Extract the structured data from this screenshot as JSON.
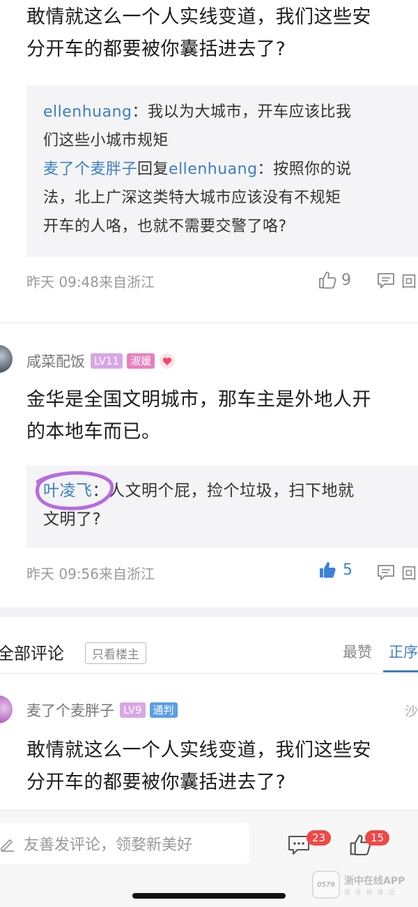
{
  "comment_top": {
    "text_line1": "敢情就这么一个人实线变道，我们这些安",
    "text_line2": "分开车的都要被你囊括进去了?",
    "replies": [
      {
        "user": "ellenhuang",
        "sep": "：",
        "text1": "我以为大城市，开车应该比我",
        "text2": "们这些小城市规矩"
      },
      {
        "user": "麦了个麦胖子",
        "action": "回复",
        "target": "ellenhuang",
        "sep": "：",
        "text1": "按照你的说",
        "text2": "法，北上广深这类特大城市应该没有不规矩",
        "text3": "开车的人咯，也就不需要交警了咯?"
      }
    ],
    "meta": "昨天 09:48来自浙江",
    "likes": "9",
    "reply_label": "回"
  },
  "comment_second": {
    "user": "咸菜配饭",
    "level_badge": "LV11",
    "title_badge": "淑媛",
    "text_line1": "金华是全国文明城市，那车主是外地人开",
    "text_line2": "的本地车而已。",
    "reply": {
      "user": "叶凌飞",
      "sep": "：",
      "text1": "人文明个屁，捡个垃圾，扫下地就",
      "text2": "文明了?"
    },
    "meta": "昨天 09:56来自浙江",
    "likes": "5",
    "reply_label": "回"
  },
  "comments_header": {
    "title": "全部评论",
    "filter_button": "只看楼主",
    "sort_hot": "最赞",
    "sort_order": "正序"
  },
  "comment_third": {
    "user": "麦了个麦胖子",
    "level_badge": "LV9",
    "title_badge": "通判",
    "right_label": "沙",
    "text_line1": "敢情就这么一个人实线变道，我们这些安",
    "text_line2": "分开车的都要被你囊括进去了?"
  },
  "bottom_bar": {
    "input_placeholder": "友善发评论，领婺新美好",
    "comment_count": "23",
    "like_count": "15"
  },
  "watermark": {
    "name": "浙中在线APP",
    "slogan": "就 在 你 身 边",
    "logo_text": "0579"
  },
  "colors": {
    "link_blue": "#3c7fbf",
    "level_badge": "#d9a6e6",
    "title_badge_pink": "#e97fbf",
    "title_badge_blue": "#5b9ee6",
    "like_active": "#3b82d8",
    "notification_red": "#f04848",
    "highlight_circle": "#b76be0"
  }
}
